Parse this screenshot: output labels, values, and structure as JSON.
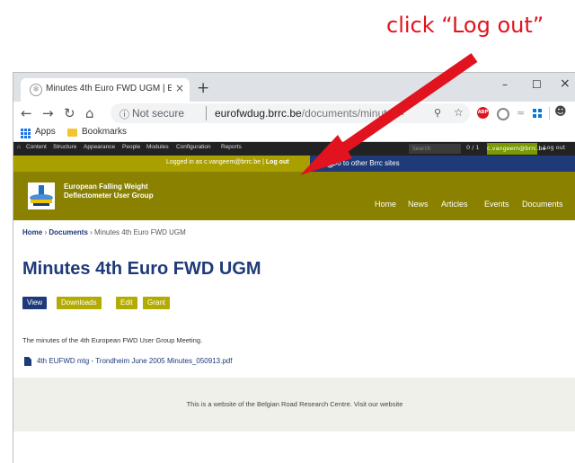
{
  "annotation": {
    "text": "click “Log out”"
  },
  "browser": {
    "tab_title": "Minutes 4th Euro FWD UGM | Eu",
    "tab_close": "×",
    "new_tab": "+",
    "win_min": "–",
    "win_max": "☐",
    "win_close": "×",
    "nav_back": "←",
    "nav_forward": "→",
    "nav_reload": "↻",
    "nav_home": "⌂",
    "not_secure": "Not secure",
    "url_domain": "eurofwdug.brrc.be",
    "url_path": "/documents/minutes-4th",
    "bookmarks": {
      "apps": "Apps",
      "folder": "Bookmarks"
    }
  },
  "admin_toolbar": {
    "items": [
      "Content",
      "Structure",
      "Appearance",
      "People",
      "Modules",
      "Configuration",
      "Reports"
    ],
    "search_placeholder": "Search",
    "count": "0 / 1",
    "user": "c.vangeem@brrc.be",
    "logout": "Log out"
  },
  "login_bar": {
    "prefix": "Logged in as c.vangeem@brrc.be | ",
    "logout": "Log out",
    "goto": "Go to other Brrc sites"
  },
  "site": {
    "name_line1": "European Falling Weight",
    "name_line2": "Deflectometer User Group",
    "nav": [
      "Home",
      "News",
      "Articles",
      "Events",
      "Documents"
    ]
  },
  "breadcrumb": {
    "home": "Home",
    "sep": " › ",
    "section": "Documents",
    "current": "Minutes 4th Euro FWD UGM"
  },
  "page": {
    "title": "Minutes 4th Euro FWD UGM",
    "tabs": [
      {
        "label": "View",
        "color": "#1f3a78"
      },
      {
        "label": "Downloads",
        "color": "#b3ab00"
      },
      {
        "label": "Edit",
        "color": "#b3ab00"
      },
      {
        "label": "Grant",
        "color": "#b3ab00"
      }
    ],
    "description": "The minutes of the 4th European FWD User Group Meeting.",
    "file": "4th EUFWD mtg - Trondheim June 2005 Minutes_050913.pdf"
  },
  "footer": {
    "text": "This is a website of the Belgian Road Research Centre. Visit our website"
  },
  "colors": {
    "accent_olive": "#8a8100",
    "brand_navy": "#1f3a78",
    "annotation_red": "#e0131f"
  }
}
